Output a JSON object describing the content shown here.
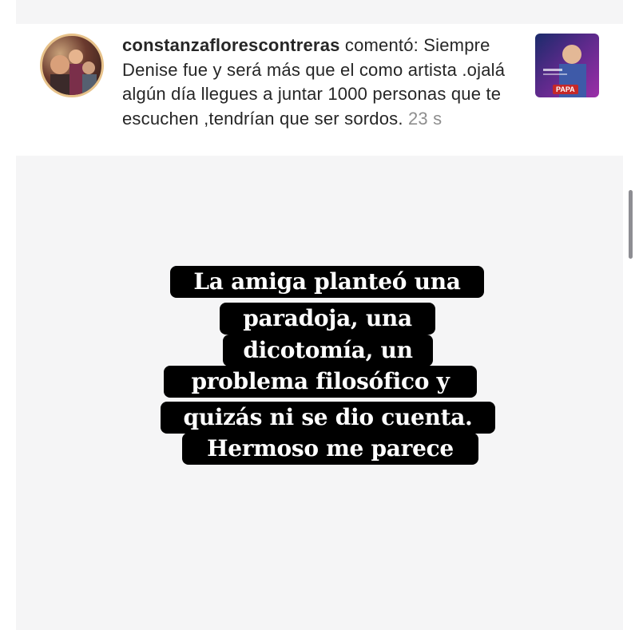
{
  "comment": {
    "username": "constanzaflorescontreras",
    "action": "comentó:",
    "text": "Siempre Denise fue y será más que el como artista .ojalá algún día llegues a juntar 1000 personas que te escuchen ,tendrían que ser sordos.",
    "time": "23 s",
    "avatar_icon": "profile-photo",
    "thumbnail_label": "PAPA"
  },
  "story": {
    "background": "#f5f5f6",
    "caption_lines": [
      "La amiga planteó una",
      "paradoja, una",
      "dicotomía, un",
      "problema filosófico y",
      "quizás ni se dio cuenta.",
      "Hermoso me parece"
    ]
  }
}
